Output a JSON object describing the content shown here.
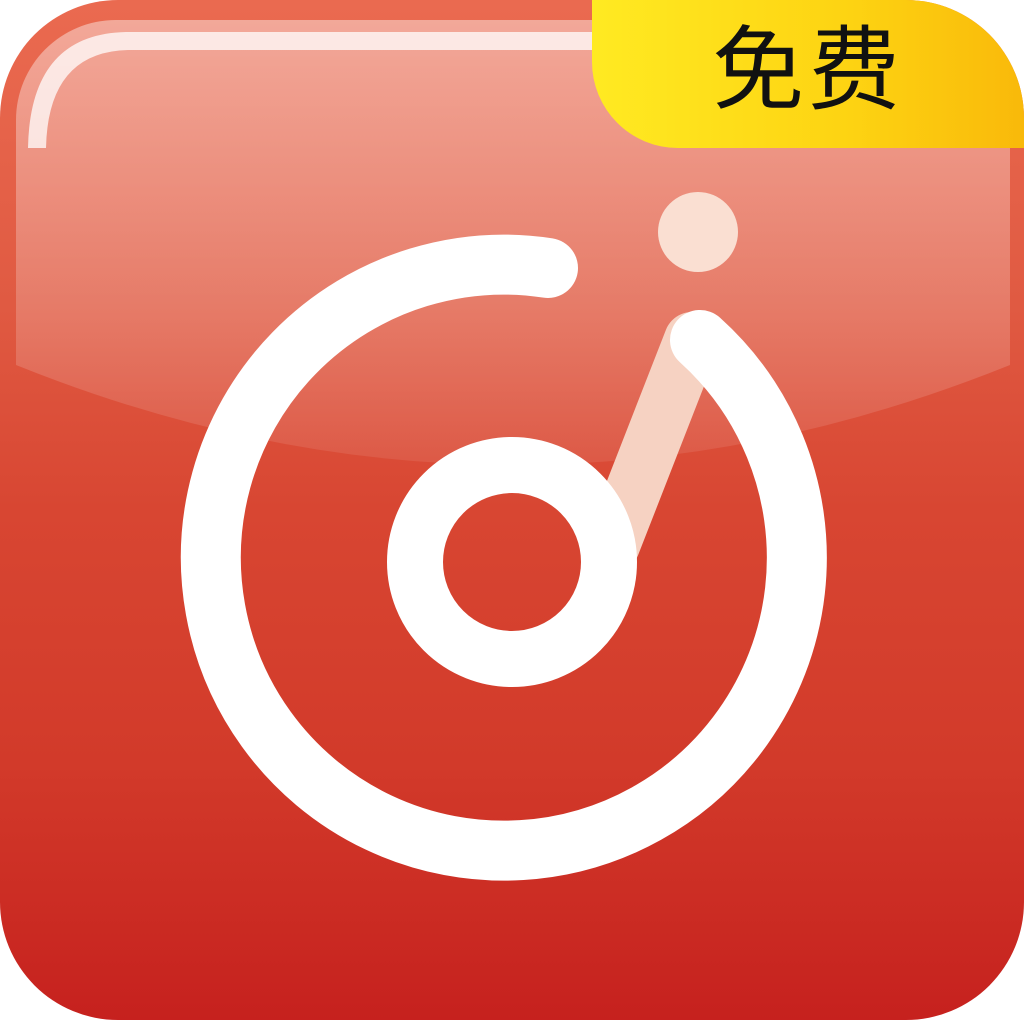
{
  "badge": {
    "label": "免费"
  },
  "colors": {
    "background_top": "#ea6a50",
    "background_bottom": "#c6211e",
    "badge_yellow": "#fdd312",
    "logo_white": "#ffffff",
    "logo_accent": "#f8d3c4"
  },
  "icons": [
    "app-logo-icon",
    "music-disc-icon"
  ]
}
